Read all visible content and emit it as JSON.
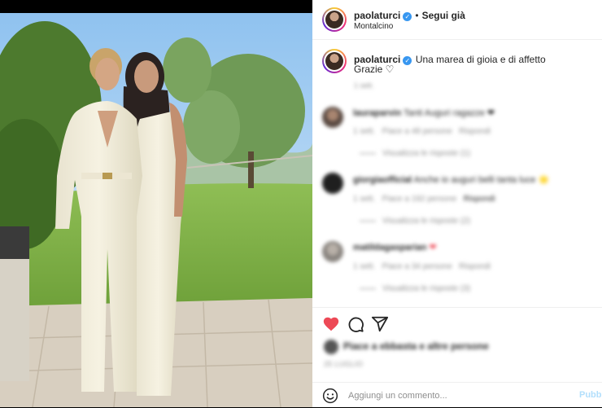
{
  "post": {
    "username": "paolaturci",
    "follow_separator": "•",
    "follow_label": "Segui già",
    "location": "Montalcino"
  },
  "caption": {
    "username": "paolaturci",
    "text": "Una marea di gioia e di affetto",
    "text_line2": "Grazie ♡",
    "time": "1 sett."
  },
  "comments": [
    {
      "username": "lauraparvin",
      "text": "Tanti Auguri ragazze ❤",
      "time": "1 sett.",
      "likes": "Piace a 48 persone",
      "reply": "Rispondi",
      "view_replies": "Visualizza le risposte (1)"
    },
    {
      "username": "giorgiaofficial",
      "text": "Anche io auguri belli tanta luce 🌟",
      "time": "1 sett.",
      "likes": "Piace a 192 persone",
      "reply": "Rispondi",
      "view_replies": "Visualizza le risposte (2)"
    },
    {
      "username": "matildagasparian",
      "text": "❤",
      "time": "1 sett.",
      "likes": "Piace a 34 persone",
      "reply": "Rispondi",
      "view_replies": "Visualizza le risposte (3)"
    }
  ],
  "actions": {
    "like_icon": "heart-filled-icon",
    "comment_icon": "comment-icon",
    "share_icon": "share-icon",
    "like_color": "#ed4956"
  },
  "likes_line": "Piace a ebbasta e altre persone",
  "date": "25 LUGLIO",
  "add_comment": {
    "emoji_icon": "emoji-icon",
    "placeholder": "Aggiungi un commento...",
    "publish_label": "Pubbl"
  }
}
